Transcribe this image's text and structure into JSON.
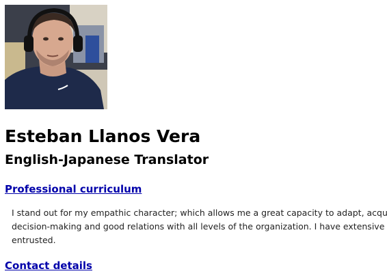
{
  "profile": {
    "photo_alt": "Esteban Llanos Vera",
    "name": "Esteban Llanos Vera",
    "title": "English-Japanese Translator"
  },
  "sections": {
    "curriculum_link": "Professional curriculum",
    "summary_lines": [
      "I stand out for my empathic character; which allows me a great capacity to adapt, acquire",
      "decision-making and good relations with all levels of the organization. I have extensive ex",
      "entrusted."
    ],
    "contact_link": "Contact details"
  },
  "colors": {
    "link": "#0000aa",
    "text": "#000000",
    "body_text": "#222222",
    "background": "#ffffff"
  }
}
